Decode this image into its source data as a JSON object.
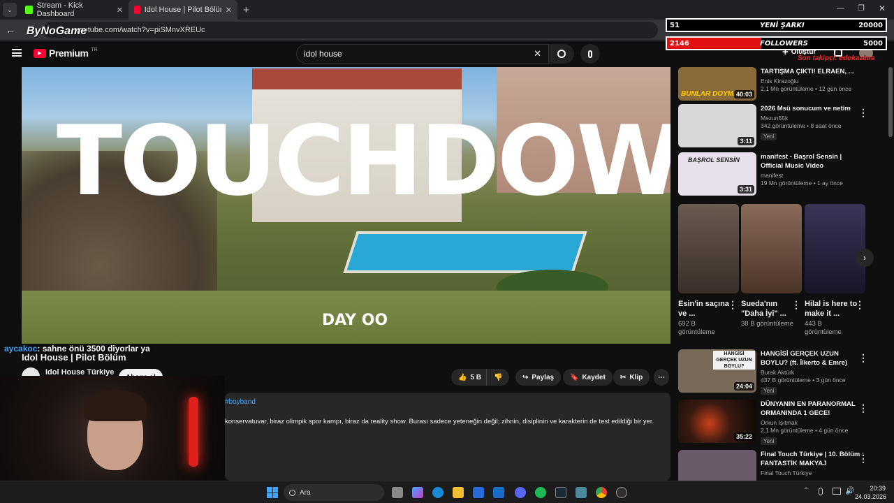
{
  "browser": {
    "tabs": [
      {
        "title": "Stream - Kick Dashboard",
        "favicon_color": "#53fc18"
      },
      {
        "title": "Idol House | Pilot Bölüm - YouT",
        "favicon_color": "#ff0033"
      }
    ],
    "new_tab_label": "+",
    "url": "youtube.com/watch?v=piSMnvXREUc"
  },
  "youtube": {
    "logo_text": "Premium",
    "logo_superscript": "TR",
    "search_value": "idol house",
    "create_label": "Oluştur"
  },
  "video": {
    "overlay_big_text": "TOUCHDOWN",
    "overlay_day_text": "DAY OO",
    "title": "Idol House | Pilot Bölüm",
    "channel": "Idol House Türkiye",
    "subscribe_label": "Abone ol",
    "likes": "5 B",
    "share_label": "Paylaş",
    "save_label": "Kaydet",
    "clip_label": "Klip",
    "hashtag": "#boyband",
    "description": "konservatuvar, biraz olimpik spor kampı, biraz da reality show. Burası sadece yeteneğin değil; zihnin, disiplinin ve karakterin de test edildiği bir yer."
  },
  "chat_message": {
    "user": "aycakoc",
    "text": ": sahne önü 3500 diyorlar ya"
  },
  "stream_overlay": {
    "watermark": "ByNoGame",
    "row1": {
      "left": "51",
      "center": "YENİ ŞARKI",
      "right": "20000"
    },
    "row2": {
      "left": "2146",
      "center": "FOLLOWERS",
      "right": "5000",
      "progress": 0.43
    },
    "last_follower": "Son takipçi: edokazima"
  },
  "recommendations_top": [
    {
      "title": "TARTIŞMA ÇIKTI! ELRAEN, ...",
      "channel": "Enis Kirazoğlu",
      "meta": "2,1 Mn görüntüleme • 12 gün önce",
      "duration": "40:03",
      "thumb_text": "BUNLAR DOYMAZ",
      "color": "#8a6a3a"
    },
    {
      "title": "2026 Msü sonucum ve netim",
      "channel": "Mezun55k",
      "meta": "342 görüntüleme • 8 saat önce",
      "badge": "Yeni",
      "duration": "3:11",
      "color": "#d8d8d8"
    },
    {
      "title": "manifest - Başrol Sensin | Official Music Video",
      "channel": "manifest",
      "meta": "19 Mn görüntüleme • 1 ay önce",
      "duration": "3:31",
      "thumb_text": "BAŞROL SENSİN",
      "color": "#e8e0ea"
    }
  ],
  "shorts": [
    {
      "title": "Esin'in saçına ve ...",
      "views": "692 B görüntüleme",
      "color": "#5a4a40"
    },
    {
      "title": "Sueda'nın \"Daha İyi\" ...",
      "views": "38 B görüntüleme",
      "color": "#6a4a3e"
    },
    {
      "title": "Hilal is here to make it ...",
      "views": "443 B görüntüleme",
      "color": "#2a2440"
    }
  ],
  "recommendations_bottom": [
    {
      "title": "HANGİSİ GERÇEK UZUN BOYLU? (ft. İlkerto & Emre)",
      "channel": "Burak Aktürk",
      "meta": "437 B görüntüleme • 3 gün önce",
      "badge": "Yeni",
      "duration": "24:04",
      "thumb_text": "HANGİSİ GERÇEK UZUN BOYLU?",
      "color": "#7a6a5a"
    },
    {
      "title": "DÜNYANIN EN PARANORMAL ORMANINDA 1 GECE!",
      "channel": "Orkun Işıtmak",
      "meta": "2,1 Mn görüntüleme • 4 gün önce",
      "badge": "Yeni",
      "duration": "35:22",
      "color": "#2a1a14"
    },
    {
      "title": "Final Touch Türkiye | 10. Bölüm : FANTASTİK MAKYAJ",
      "channel": "Final Touch Türkiye",
      "meta": "",
      "color": "#6a5a6a"
    }
  ],
  "taskbar": {
    "search_label": "Ara",
    "time": "20:39",
    "date": "24.03.2026"
  },
  "colors": {
    "accent": "#ff0033",
    "overlay_red": "#e01010"
  }
}
